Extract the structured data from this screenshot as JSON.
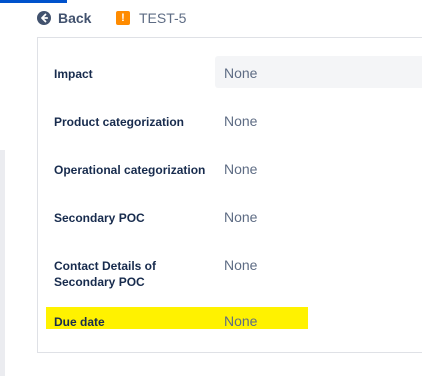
{
  "header": {
    "back_label": "Back",
    "issue_key": "TEST-5",
    "issue_type_glyph": "!"
  },
  "fields": [
    {
      "label": "Impact",
      "value": "None"
    },
    {
      "label": "Product categorization",
      "value": "None"
    },
    {
      "label": "Operational categorization",
      "value": "None"
    },
    {
      "label": "Secondary POC",
      "value": "None"
    },
    {
      "label_line1": "Contact Details of",
      "label_line2": "Secondary POC",
      "value": "None"
    },
    {
      "label": "Due date",
      "value": "None"
    }
  ],
  "colors": {
    "highlight": "#fff200",
    "issue_type": "#ff8b00",
    "accent": "#0052cc"
  },
  "icons": {
    "back": "arrow-left-circle-icon",
    "issue_type": "exclamation-square-icon"
  }
}
